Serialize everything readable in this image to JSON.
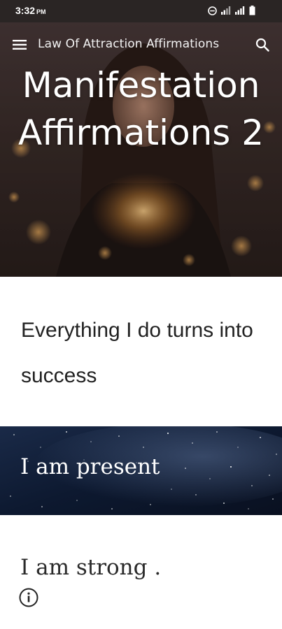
{
  "status_bar": {
    "time": "3:32",
    "ampm": "PM"
  },
  "header": {
    "site_title": "Law Of Attraction Affirmations",
    "menu_icon": "menu-icon",
    "search_icon": "search-icon"
  },
  "hero": {
    "title": "Manifestation Affirmations 2"
  },
  "content": {
    "affirmation_1": "Everything I do turns into success",
    "banner_text": "I am present",
    "affirmation_2": "I am strong ."
  },
  "footer": {
    "info_icon": "info-icon"
  },
  "colors": {
    "status_bar_bg": "#2a2524",
    "text_dark": "#222222",
    "banner_bg": "#0b1426"
  }
}
